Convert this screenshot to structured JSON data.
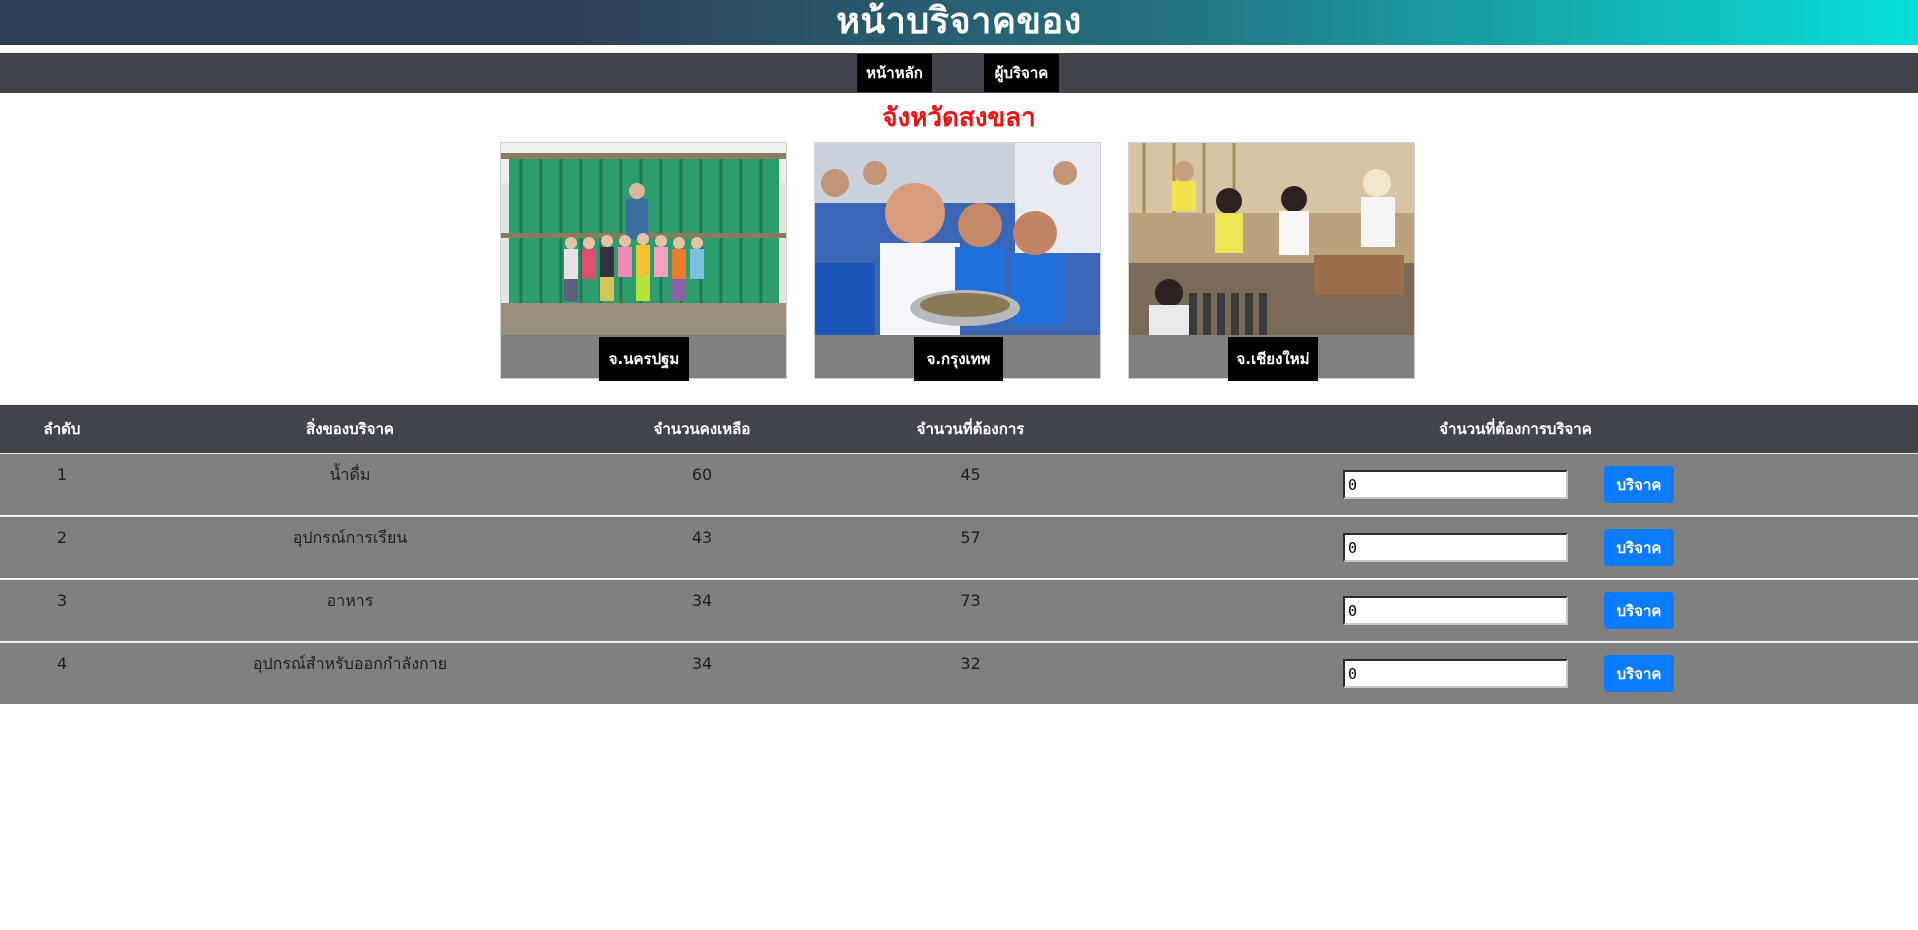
{
  "header": {
    "title": "หน้าบริจาคของ"
  },
  "nav": {
    "home": "หน้าหลัก",
    "donors": "ผู้บริจาค"
  },
  "province": {
    "title": "จังหวัดสงขลา"
  },
  "cards": [
    {
      "label": "จ.นครปฐม"
    },
    {
      "label": "จ.กรุงเทพ"
    },
    {
      "label": "จ.เชียงใหม่"
    }
  ],
  "table": {
    "headers": [
      "ลำดับ",
      "สิ่งของบริจาค",
      "จำนวนคงเหลือ",
      "จำนวนที่ต้องการ",
      "จำนวนที่ต้องการบริจาค"
    ],
    "rows": [
      {
        "no": "1",
        "item": "น้ำดื่ม",
        "remaining": "60",
        "needed": "45",
        "qty": "0",
        "button": "บริจาค"
      },
      {
        "no": "2",
        "item": "อุปกรณ์การเรียน",
        "remaining": "43",
        "needed": "57",
        "qty": "0",
        "button": "บริจาค"
      },
      {
        "no": "3",
        "item": "อาหาร",
        "remaining": "34",
        "needed": "73",
        "qty": "0",
        "button": "บริจาค"
      },
      {
        "no": "4",
        "item": "อุปกรณ์สำหรับออกกำลังกาย",
        "remaining": "34",
        "needed": "32",
        "qty": "0",
        "button": "บริจาค"
      }
    ]
  }
}
